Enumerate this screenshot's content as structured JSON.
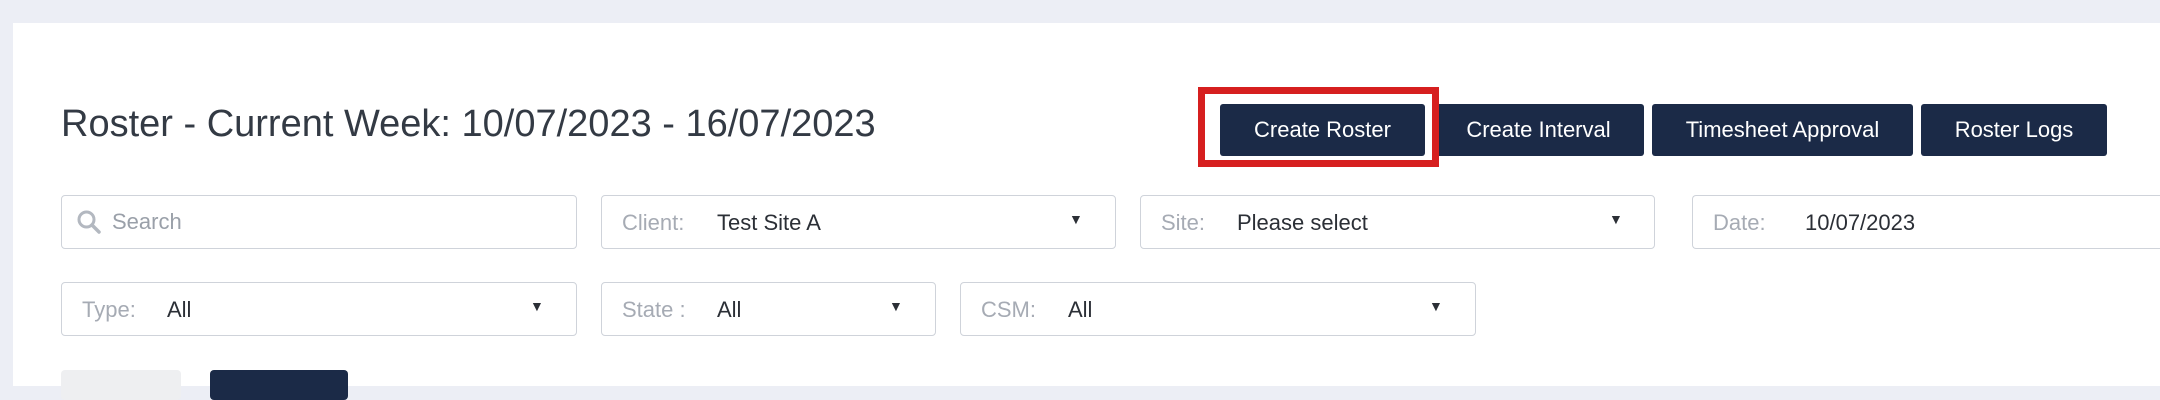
{
  "header": {
    "title": "Roster - Current Week: 10/07/2023 - 16/07/2023"
  },
  "actions": {
    "create_roster": "Create Roster",
    "create_interval": "Create Interval",
    "timesheet_approval": "Timesheet Approval",
    "roster_logs": "Roster Logs"
  },
  "filters": {
    "search": {
      "placeholder": "Search",
      "value": ""
    },
    "client": {
      "label": "Client:",
      "value": "Test Site A"
    },
    "site": {
      "label": "Site:",
      "value": "Please select"
    },
    "date": {
      "label": "Date:",
      "value": "10/07/2023"
    },
    "type": {
      "label": "Type:",
      "value": "All"
    },
    "state": {
      "label": "State :",
      "value": "All"
    },
    "csm": {
      "label": "CSM:",
      "value": "All"
    }
  },
  "icons": {
    "search": "search-icon",
    "dropdown": "caret-down-icon"
  },
  "colors": {
    "primary_button": "#1b2a47",
    "highlight": "#d61f1f",
    "background": "#eceef5"
  }
}
